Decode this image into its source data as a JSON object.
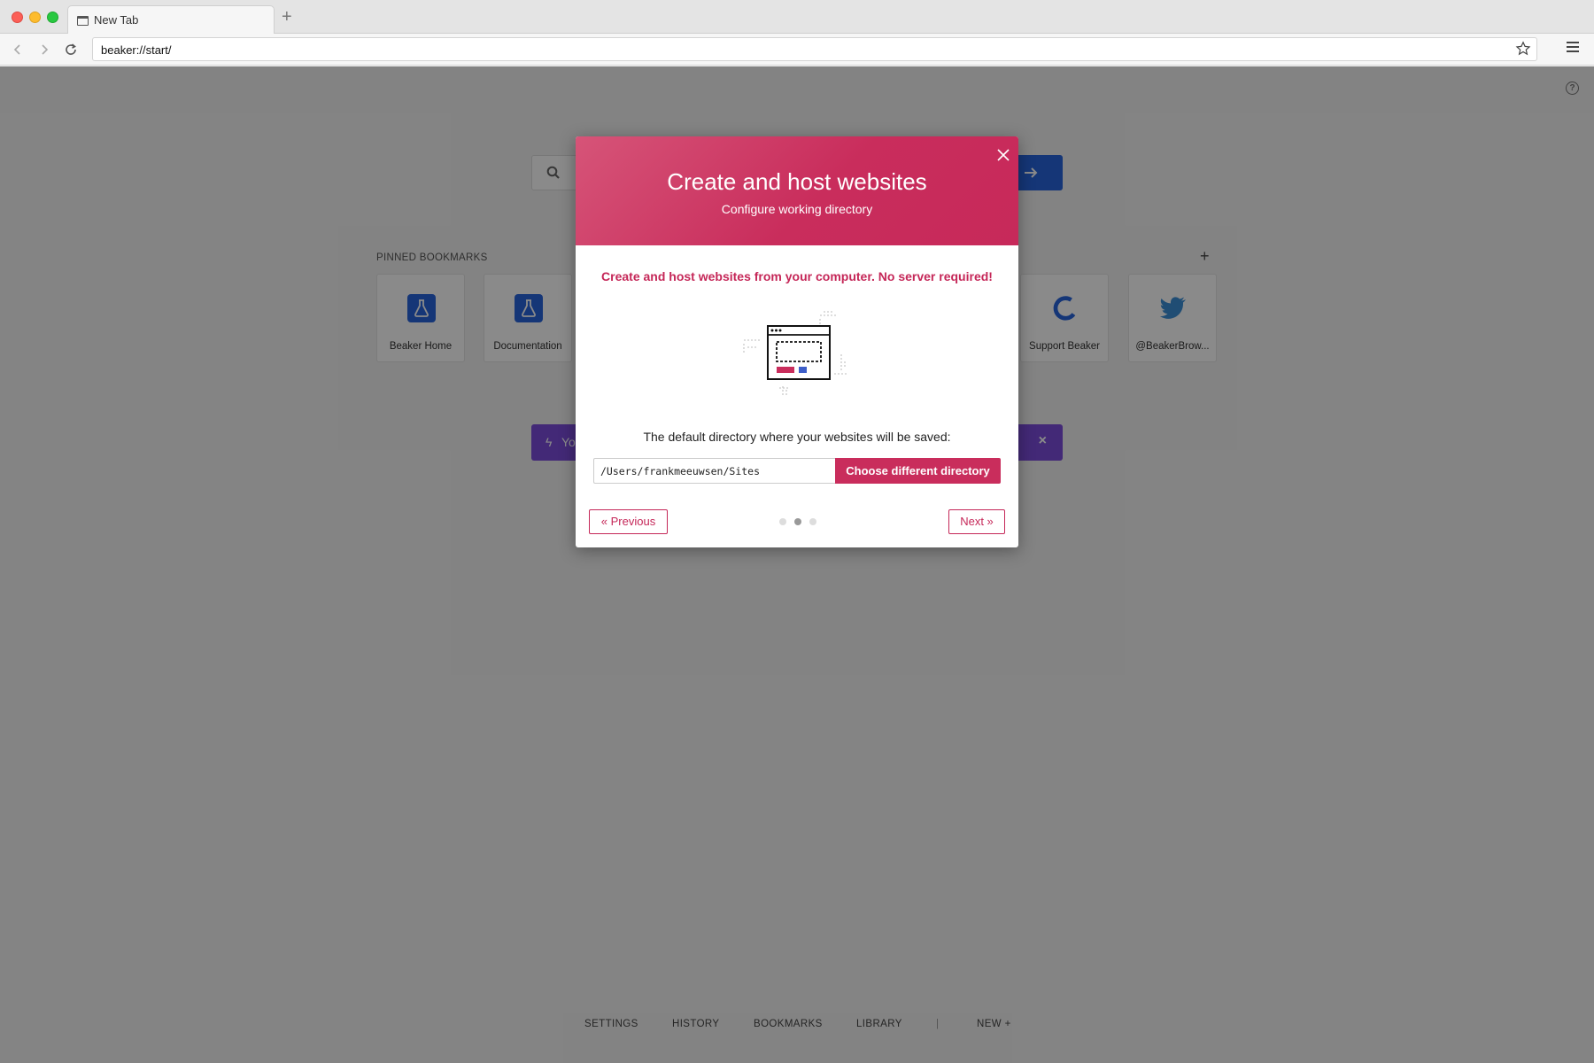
{
  "browser": {
    "tab_title": "New Tab",
    "new_tab_label": "+",
    "url": "beaker://start/"
  },
  "start_page": {
    "pinned_label": "PINNED BOOKMARKS",
    "pinned_add": "+",
    "bookmarks": [
      {
        "label": "Beaker Home",
        "icon": "beaker-icon"
      },
      {
        "label": "Documentation",
        "icon": "beaker-icon"
      },
      {
        "label": "Support Beaker",
        "icon": "support-icon"
      },
      {
        "label": "@BeakerBrow...",
        "icon": "twitter-icon"
      }
    ],
    "banner_text": "Yo",
    "banner_close": "×",
    "footer": {
      "settings": "SETTINGS",
      "history": "HISTORY",
      "bookmarks": "BOOKMARKS",
      "library": "LIBRARY",
      "separator": "|",
      "new": "NEW +"
    }
  },
  "modal": {
    "title": "Create and host websites",
    "subtitle": "Configure working directory",
    "tagline": "Create and host websites from your computer. No server required!",
    "description": "The default directory where your websites will be saved:",
    "directory_value": "/Users/frankmeeuwsen/Sites",
    "choose_button": "Choose different directory",
    "previous_button": "« Previous",
    "next_button": "Next »",
    "steps_total": 3,
    "current_step": 2
  },
  "colors": {
    "accent": "#c92d5c",
    "header_gradient_start": "#d65478",
    "header_gradient_end": "#c7295a",
    "beaker_blue": "#2864dc",
    "banner_purple": "#7c4ddc"
  }
}
